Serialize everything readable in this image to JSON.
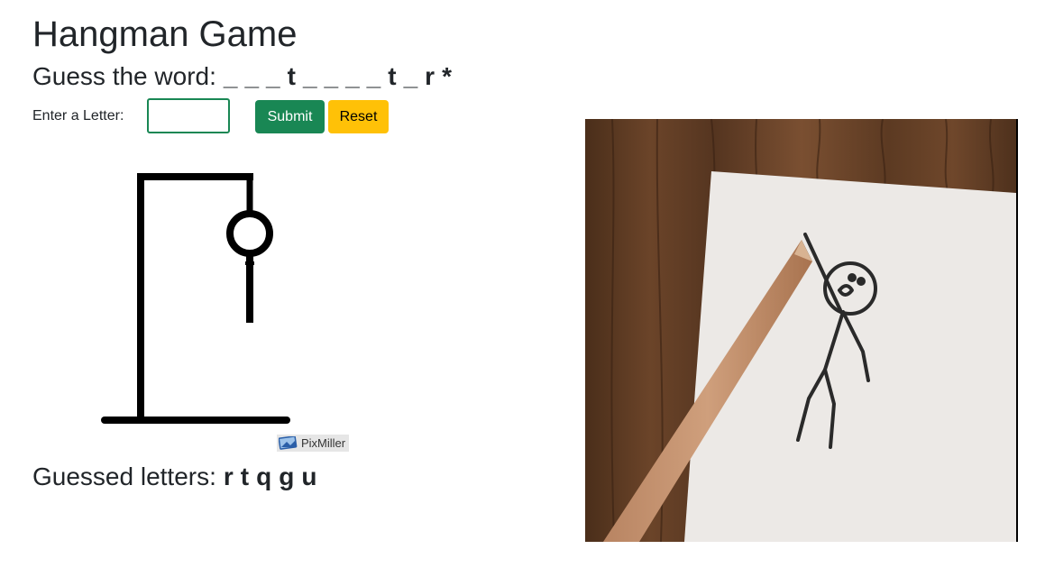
{
  "title": "Hangman Game",
  "word_prompt": "Guess the word:",
  "word_slots": [
    "_",
    "_",
    "_",
    "t",
    "_",
    "_",
    "_",
    "_",
    "t",
    "_",
    "r",
    "*"
  ],
  "input": {
    "label": "Enter a Letter:",
    "value": "",
    "placeholder": ""
  },
  "buttons": {
    "submit": "Submit",
    "reset": "Reset"
  },
  "watermark": {
    "text": "PixMiller"
  },
  "guessed": {
    "label": "Guessed letters:",
    "letters": [
      "r",
      "t",
      "q",
      "g",
      "u"
    ]
  },
  "game": {
    "wrong_guesses": 2
  },
  "colors": {
    "submit_bg": "#198754",
    "reset_bg": "#ffc107",
    "input_border": "#198754",
    "wood": "#5a3a22"
  }
}
